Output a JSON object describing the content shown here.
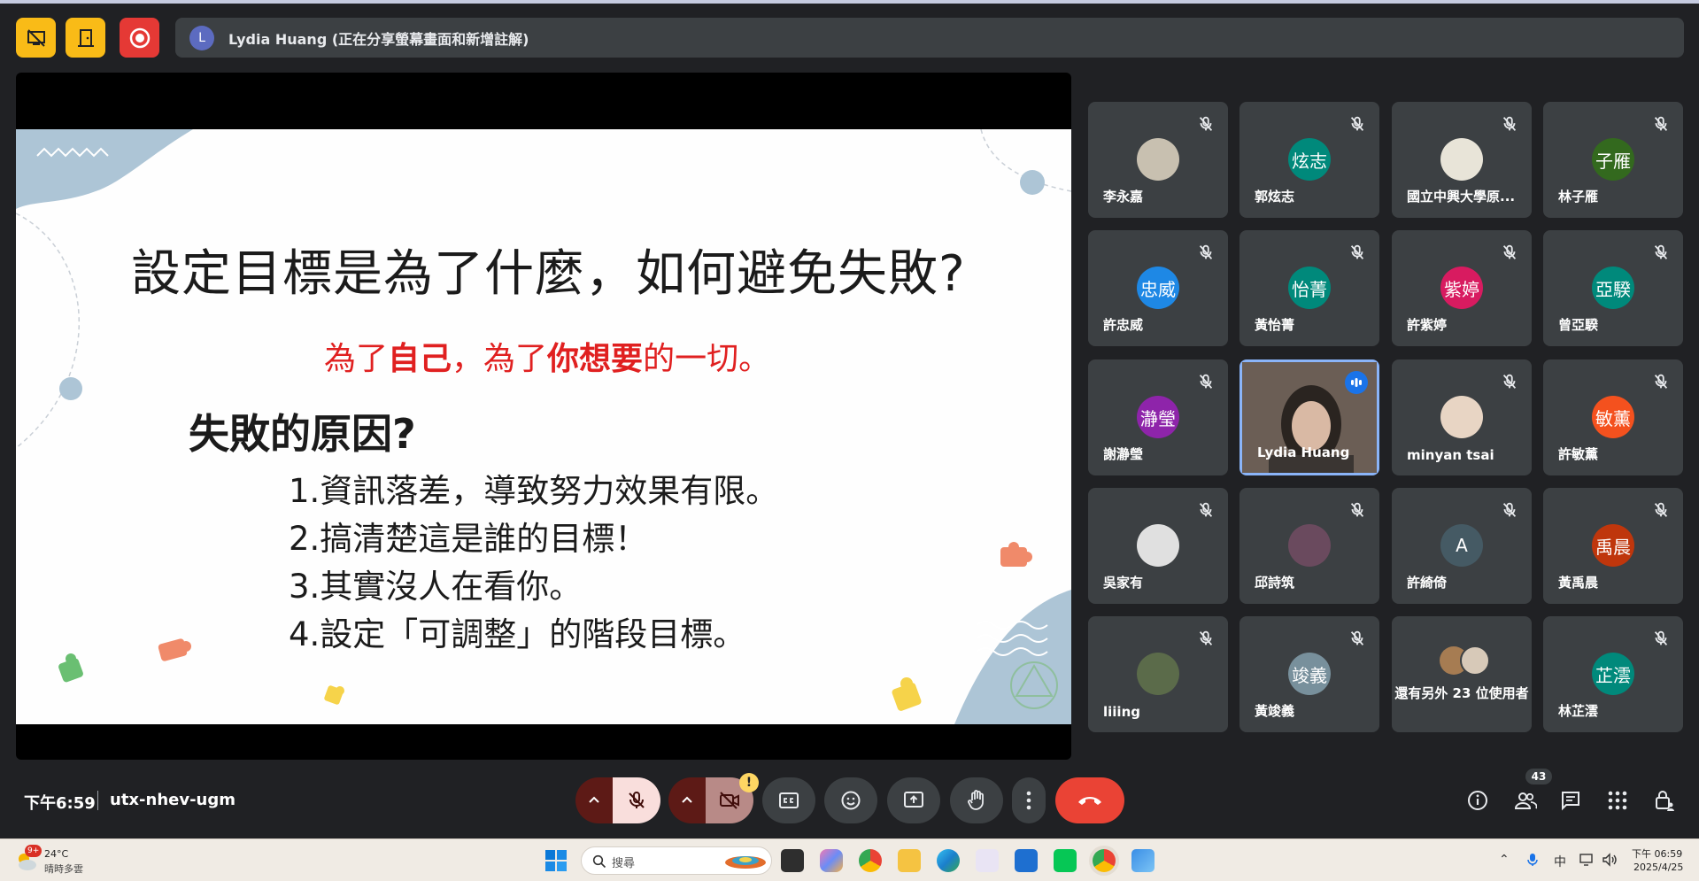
{
  "topbar": {
    "presenter_initial": "L",
    "presenter_text": "Lydia Huang (正在分享螢幕畫面和新增註解)"
  },
  "slide": {
    "title": "設定目標是為了什麼，如何避免失敗?",
    "subtitle_parts": [
      "為了",
      "自己",
      "，為了",
      "你想要",
      "的一切。"
    ],
    "heading": "失敗的原因?",
    "items": [
      "1.資訊落差，導致努力效果有限。",
      "2.搞清楚這是誰的目標！",
      "3.其實沒人在看你。",
      "4.設定「可調整」的階段目標。"
    ]
  },
  "participants": [
    {
      "name": "李永嘉",
      "initials": "",
      "color": "#c8c0b0"
    },
    {
      "name": "郭炫志",
      "initials": "炫志",
      "color": "#00897b"
    },
    {
      "name": "國立中興大學原...",
      "initials": "",
      "color": "#e8e4d8"
    },
    {
      "name": "林子雁",
      "initials": "子雁",
      "color": "#33691e"
    },
    {
      "name": "許忠威",
      "initials": "忠威",
      "color": "#1e88e5"
    },
    {
      "name": "黃怡菁",
      "initials": "怡菁",
      "color": "#00897b"
    },
    {
      "name": "許紫婷",
      "initials": "紫婷",
      "color": "#d81b60"
    },
    {
      "name": "曾亞騤",
      "initials": "亞騤",
      "color": "#00897b"
    },
    {
      "name": "謝瀞瑩",
      "initials": "瀞瑩",
      "color": "#8e24aa"
    },
    {
      "name": "Lydia Huang",
      "initials": "",
      "color": "#5a4f48"
    },
    {
      "name": "minyan tsai",
      "initials": "",
      "color": "#e8d5c4"
    },
    {
      "name": "許敏薰",
      "initials": "敏薰",
      "color": "#f4511e"
    },
    {
      "name": "吳家有",
      "initials": "",
      "color": "#e0e0e0"
    },
    {
      "name": "邱詩筑",
      "initials": "",
      "color": "#6a4a5e"
    },
    {
      "name": "許綺倚",
      "initials": "A",
      "color": "#455a64"
    },
    {
      "name": "黃禹晨",
      "initials": "禹晨",
      "color": "#bf360c"
    },
    {
      "name": "liiing",
      "initials": "",
      "color": "#5b6b4a"
    },
    {
      "name": "黃竣義",
      "initials": "竣義",
      "color": "#78909c"
    },
    {
      "name": "還有另外 23 位使用者",
      "initials": "",
      "color": ""
    },
    {
      "name": "林芷澐",
      "initials": "芷澐",
      "color": "#00897b"
    }
  ],
  "meeting": {
    "time": "下午6:59",
    "code": "utx-nhev-ugm",
    "people_count": "43",
    "warning": "!"
  },
  "taskbar": {
    "weather_badge": "9+",
    "temperature": "24°C",
    "weather_desc": "晴時多雲",
    "search_placeholder": "搜尋",
    "ime": "中",
    "clock_time": "下午 06:59",
    "clock_date": "2025/4/25"
  },
  "colors": {
    "accent_yellow": "#f9bb17",
    "record_red": "#e53935",
    "end_call": "#ea4335",
    "slide_red": "#e02020",
    "active_border": "#8ab4f8"
  }
}
